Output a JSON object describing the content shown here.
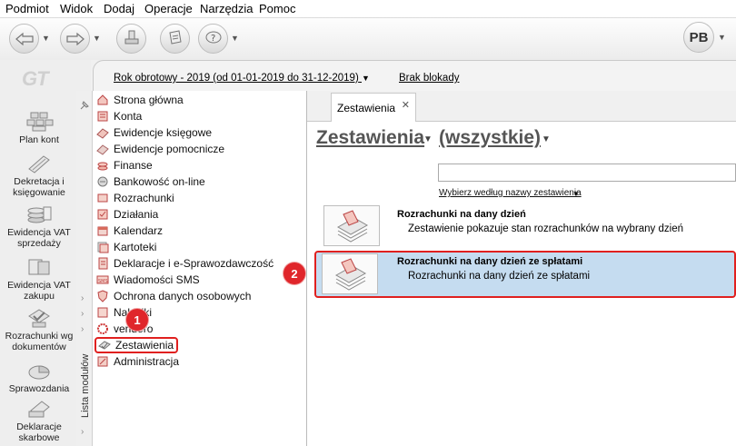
{
  "menu": [
    "Podmiot",
    "Widok",
    "Dodaj",
    "Operacje",
    "Narzędzia",
    "Pomoc"
  ],
  "toolbar": {
    "user_initials": "PB"
  },
  "logo": "GT",
  "leftnav": [
    {
      "label": "Plan kont",
      "icon": "plan-kont-icon"
    },
    {
      "label": "Dekretacja i księgowanie",
      "icon": "dekretacja-icon"
    },
    {
      "label": "Ewidencja VAT sprzedaży",
      "icon": "vat-sprzedaz-icon"
    },
    {
      "label": "Ewidencja VAT zakupu",
      "icon": "vat-zakup-icon"
    },
    {
      "label": "Rozrachunki wg dokumentów",
      "icon": "rozrachunki-icon"
    },
    {
      "label": "Sprawozdania",
      "icon": "sprawozdania-icon"
    },
    {
      "label": "Deklaracje skarbowe",
      "icon": "deklaracje-icon"
    }
  ],
  "infobar": {
    "year": "Rok obrotowy - 2019  (od 01-01-2019 do 31-12-2019)",
    "lock": "Brak blokady"
  },
  "modules_label": "Lista modułów",
  "modules": [
    "Strona główna",
    "Konta",
    "Ewidencje księgowe",
    "Ewidencje pomocnicze",
    "Finanse",
    "Bankowość on-line",
    "Rozrachunki",
    "Działania",
    "Kalendarz",
    "Kartoteki",
    "Deklaracje i e-Sprawozdawczość",
    "Wiadomości SMS",
    "Ochrona danych osobowych",
    "Naklejki",
    "vendero",
    "Zestawienia",
    "Administracja"
  ],
  "tab": {
    "label": "Zestawienia"
  },
  "content": {
    "title": "Zestawienia",
    "filter_value": "(wszystkie)",
    "search_placeholder": "",
    "filter_link": "Wybierz według nazwy zestawienia",
    "reports": [
      {
        "title": "Rozrachunki na dany dzień",
        "desc": "Zestawienie pokazuje stan rozrachunków na wybrany dzień"
      },
      {
        "title": "Rozrachunki na dany dzień ze spłatami",
        "desc": "Rozrachunki na dany dzień ze spłatami"
      }
    ]
  },
  "badges": [
    "1",
    "2"
  ],
  "colors": {
    "highlight": "#c5dcf0",
    "annotation": "#e0201f"
  }
}
